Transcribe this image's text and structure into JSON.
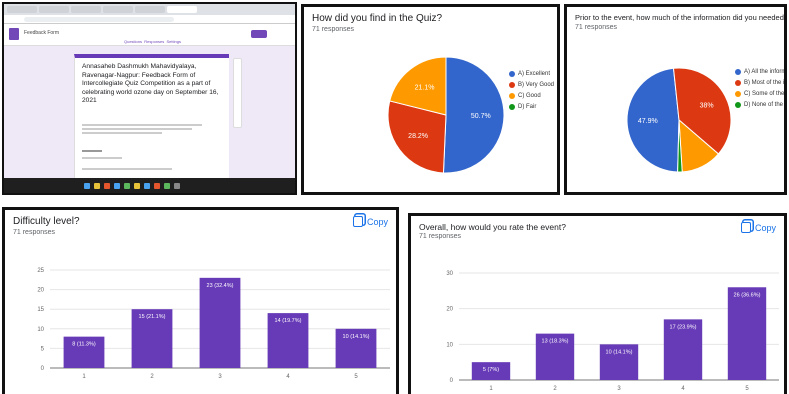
{
  "screenshot": {
    "form_name": "Feedback Form",
    "form_title": "Annasaheb Dashmukh Mahavidyalaya, Ravenagar-Nagpur: Feedback Form of Intercollegiate Quiz Competition as a part of celebrating world ozone day on September 16, 2021",
    "tabs": [
      "Questions",
      "Responses",
      "Settings"
    ]
  },
  "common": {
    "copy_label": "Copy"
  },
  "pie1": {
    "title": "How did you find in the Quiz?",
    "subtitle": "71 responses"
  },
  "pie2": {
    "title": "Prior to the event, how much of the information did you needed did you get?",
    "subtitle": "71 responses"
  },
  "bar1": {
    "title": "Difficulty level?",
    "subtitle": "71 responses"
  },
  "bar2": {
    "title": "Overall, how would you rate the event?",
    "subtitle": "71 responses"
  },
  "colors": {
    "blue": "#3366cc",
    "red": "#dc3912",
    "orange": "#ff9900",
    "green": "#109618",
    "purple": "#673ab7"
  },
  "chart_data": [
    {
      "type": "pie",
      "title": "How did you find in the Quiz?",
      "categories": [
        "A) Excellent",
        "B) Very Good",
        "C) Good",
        "D) Fair"
      ],
      "values": [
        50.7,
        28.2,
        21.1,
        0
      ],
      "labels": [
        "50.7%",
        "28.2%",
        "21.1%",
        ""
      ],
      "colors": [
        "#3366cc",
        "#dc3912",
        "#ff9900",
        "#109618"
      ],
      "legend": "right"
    },
    {
      "type": "pie",
      "title": "Prior to the event, how much of the information did you needed did you get?",
      "categories": [
        "A) All the information",
        "B) Most of the information",
        "C) Some of the information",
        "D) None of the information"
      ],
      "values": [
        47.9,
        38.0,
        12.7,
        1.4
      ],
      "labels": [
        "47.9%",
        "38%",
        "",
        ""
      ],
      "colors": [
        "#3366cc",
        "#dc3912",
        "#ff9900",
        "#109618"
      ],
      "legend": "right"
    },
    {
      "type": "bar",
      "title": "Difficulty level?",
      "categories": [
        "1",
        "2",
        "3",
        "4",
        "5"
      ],
      "values": [
        8,
        15,
        23,
        14,
        10
      ],
      "labels": [
        "8 (11.3%)",
        "15 (21.1%)",
        "23 (32.4%)",
        "14 (19.7%)",
        "10 (14.1%)"
      ],
      "yticks": [
        "0",
        "5",
        "10",
        "15",
        "20",
        "25"
      ],
      "ylim": [
        0,
        25
      ],
      "color": "#673ab7"
    },
    {
      "type": "bar",
      "title": "Overall, how would you rate the event?",
      "categories": [
        "1",
        "2",
        "3",
        "4",
        "5"
      ],
      "values": [
        5,
        13,
        10,
        17,
        26
      ],
      "labels": [
        "5 (7%)",
        "13 (18.3%)",
        "10 (14.1%)",
        "17 (23.9%)",
        "26 (36.6%)"
      ],
      "yticks": [
        "0",
        "10",
        "20",
        "30"
      ],
      "ylim": [
        0,
        30
      ],
      "color": "#673ab7"
    }
  ]
}
